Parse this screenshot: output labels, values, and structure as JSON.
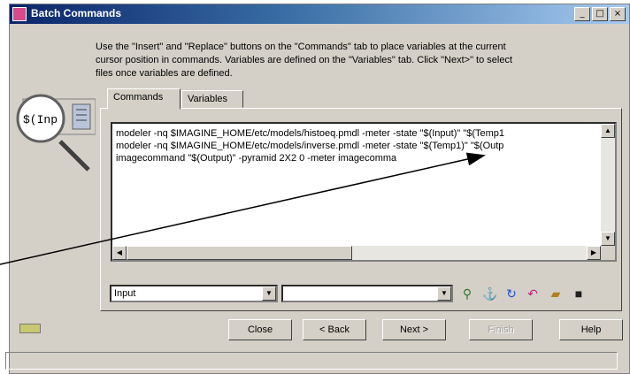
{
  "window": {
    "title": "Batch Commands",
    "controls": [
      "minimize",
      "maximize",
      "close"
    ]
  },
  "instructions": "Use the \"Insert\" and \"Replace\" buttons on the \"Commands\" tab to place variables at the current cursor position in commands. Variables are defined on the \"Variables\" tab. Click \"Next>\" to select files once variables are defined.",
  "icon_label": "$(Inp",
  "tabs": [
    {
      "label": "Commands",
      "active": true
    },
    {
      "label": "Variables",
      "active": false
    }
  ],
  "commands": [
    "modeler -nq $IMAGINE_HOME/etc/models/histoeq.pmdl -meter -state \"$(Input)\" \"$(Temp1",
    "modeler -nq $IMAGINE_HOME/etc/models/inverse.pmdl -meter -state \"$(Temp1)\" \"$(Outp",
    "imagecommand \"$(Output)\" -pyramid 2X2 0 -meter imagecomma"
  ],
  "variable_select": {
    "value": "Input"
  },
  "second_select": {
    "value": ""
  },
  "toolbar_icons": [
    "insert-variable-icon",
    "replace-variable-icon",
    "refresh-icon",
    "undo-icon",
    "open-folder-icon",
    "save-icon"
  ],
  "buttons": {
    "close": "Close",
    "back": "< Back",
    "next": "Next >",
    "finish": "Finish",
    "help": "Help"
  },
  "colors": {
    "titlebar_start": "#0a246a",
    "titlebar_end": "#a6caf0",
    "face": "#d4d0c8",
    "status_led": "#c8c870"
  }
}
